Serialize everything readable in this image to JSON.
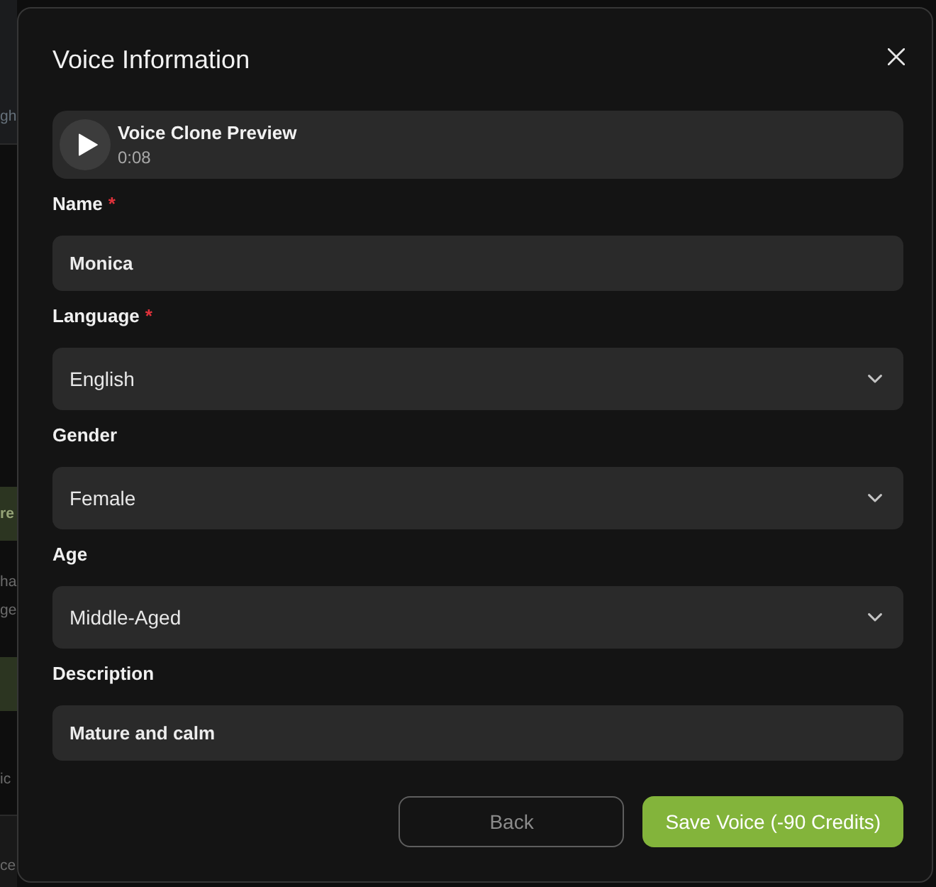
{
  "background_page": {
    "fragments": [
      {
        "kind": "header",
        "text": "gh"
      },
      {
        "kind": "button",
        "text": "re"
      },
      {
        "kind": "text",
        "text": "ha"
      },
      {
        "kind": "text",
        "text": "ge"
      },
      {
        "kind": "button"
      },
      {
        "kind": "text",
        "text": "ic"
      },
      {
        "kind": "footer",
        "text": "ce"
      }
    ]
  },
  "dialog": {
    "title": "Voice Information",
    "required_mark": "*",
    "preview": {
      "title": "Voice Clone Preview",
      "duration": "0:08"
    },
    "fields": [
      {
        "kind": "text",
        "label": "Name",
        "required": true,
        "value": "Monica"
      },
      {
        "kind": "select",
        "label": "Language",
        "required": true,
        "value": "English"
      },
      {
        "kind": "select",
        "label": "Gender",
        "required": false,
        "value": "Female"
      },
      {
        "kind": "select",
        "label": "Age",
        "required": false,
        "value": "Middle-Aged"
      },
      {
        "kind": "text",
        "label": "Description",
        "required": false,
        "value": "Mature and calm"
      }
    ],
    "buttons": [
      {
        "kind": "secondary",
        "label": "Back"
      },
      {
        "kind": "primary",
        "label": "Save Voice (-90 Credits)"
      }
    ]
  }
}
